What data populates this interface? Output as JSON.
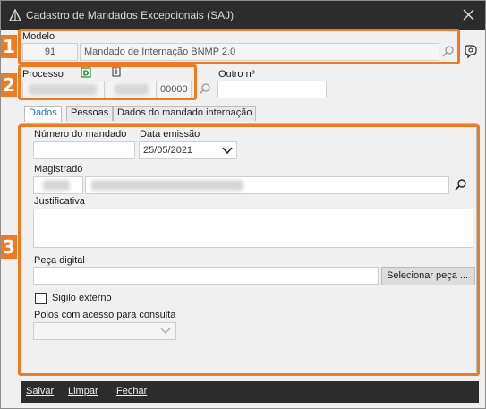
{
  "window": {
    "title": "Cadastro de Mandados Excepcionais (SAJ)"
  },
  "annotations": {
    "box1_number": "1",
    "box2_number": "2",
    "box3_number": "3",
    "color": "#ee7a22"
  },
  "modelo": {
    "label": "Modelo",
    "code": "91",
    "description": "Mandado de Internação BNMP 2.0"
  },
  "processo": {
    "label": "Processo",
    "suffix": "00000",
    "outro_label": "Outro nº",
    "outro_value": ""
  },
  "tabs": [
    {
      "label": "Dados",
      "active": true
    },
    {
      "label": "Pessoas",
      "active": false
    },
    {
      "label": "Dados do mandado internação",
      "active": false
    }
  ],
  "dados": {
    "numero_label": "Número do mandado",
    "numero_value": "",
    "data_label": "Data emissão",
    "data_value": "25/05/2021",
    "magistrado_label": "Magistrado",
    "justificativa_label": "Justificativa",
    "justificativa_value": "",
    "peca_label": "Peça digital",
    "peca_value": "",
    "selecionar_label": "Selecionar peça ...",
    "sigilo_label": "Sigilo externo",
    "sigilo_checked": false,
    "polos_label": "Polos com acesso para consulta",
    "polos_value": ""
  },
  "footer": {
    "salvar": "Salvar",
    "limpar": "Limpar",
    "fechar": "Fechar"
  }
}
